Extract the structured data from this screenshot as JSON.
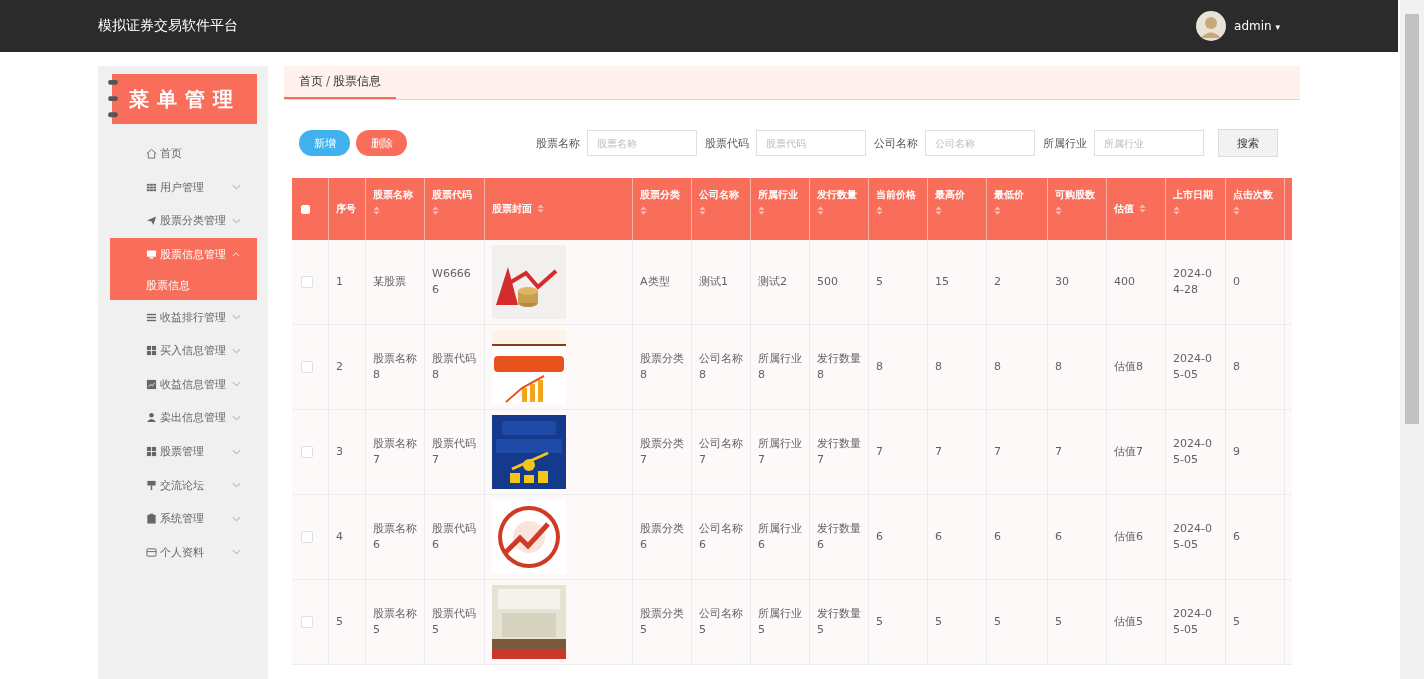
{
  "app_title": "模拟证券交易软件平台",
  "user": {
    "name": "admin",
    "caret": "▾"
  },
  "sidebar": {
    "title": "菜单管理",
    "items": [
      {
        "label": "首页",
        "kind": "home",
        "expandable": false,
        "selected": false
      },
      {
        "label": "用户管理",
        "kind": "grid",
        "expandable": true,
        "expanded": false,
        "selected": false
      },
      {
        "label": "股票分类管理",
        "kind": "plane",
        "expandable": true,
        "expanded": false,
        "selected": false
      },
      {
        "label": "股票信息管理",
        "kind": "monitor",
        "expandable": true,
        "expanded": true,
        "selected": true,
        "children": [
          {
            "label": "股票信息",
            "selected": true
          }
        ]
      },
      {
        "label": "收益排行管理",
        "kind": "list",
        "expandable": true,
        "expanded": false,
        "selected": false
      },
      {
        "label": "买入信息管理",
        "kind": "apps",
        "expandable": true,
        "expanded": false,
        "selected": false
      },
      {
        "label": "收益信息管理",
        "kind": "chart",
        "expandable": true,
        "expanded": false,
        "selected": false
      },
      {
        "label": "卖出信息管理",
        "kind": "user",
        "expandable": true,
        "expanded": false,
        "selected": false
      },
      {
        "label": "股票管理",
        "kind": "apps",
        "expandable": true,
        "expanded": false,
        "selected": false
      },
      {
        "label": "交流论坛",
        "kind": "sign",
        "expandable": true,
        "expanded": false,
        "selected": false
      },
      {
        "label": "系统管理",
        "kind": "clipboard",
        "expandable": true,
        "expanded": false,
        "selected": false
      },
      {
        "label": "个人资料",
        "kind": "card",
        "expandable": true,
        "expanded": false,
        "selected": false
      }
    ]
  },
  "breadcrumb": {
    "items": [
      "首页",
      "股票信息"
    ],
    "separator": "/"
  },
  "toolbar": {
    "buttons": [
      {
        "label": "新增",
        "kind": "add"
      },
      {
        "label": "删除",
        "kind": "delete"
      }
    ],
    "filters": [
      {
        "label": "股票名称",
        "placeholder": "股票名称"
      },
      {
        "label": "股票代码",
        "placeholder": "股票代码"
      },
      {
        "label": "公司名称",
        "placeholder": "公司名称"
      },
      {
        "label": "所属行业",
        "placeholder": "所属行业"
      }
    ],
    "search_button": "搜索"
  },
  "table": {
    "header_checked": false,
    "columns": [
      {
        "kind": "checkbox"
      },
      {
        "kind": "text",
        "label": "序号",
        "sortable": false
      },
      {
        "kind": "text",
        "label": "股票名称",
        "sortable": true
      },
      {
        "kind": "text",
        "label": "股票代码",
        "sortable": true
      },
      {
        "kind": "picture",
        "label": "股票封面",
        "sortable": true
      },
      {
        "kind": "text",
        "label": "股票分类",
        "sortable": true
      },
      {
        "kind": "text",
        "label": "公司名称",
        "sortable": true
      },
      {
        "kind": "text",
        "label": "所属行业",
        "sortable": true
      },
      {
        "kind": "text",
        "label": "发行数量",
        "sortable": true
      },
      {
        "kind": "text",
        "label": "当前价格",
        "sortable": true
      },
      {
        "kind": "text",
        "label": "最高价",
        "sortable": true
      },
      {
        "kind": "text",
        "label": "最低价",
        "sortable": true
      },
      {
        "kind": "text",
        "label": "可购股数",
        "sortable": true
      },
      {
        "kind": "text",
        "label": "估值",
        "sortable": true
      },
      {
        "kind": "text",
        "label": "上市日期",
        "sortable": true
      },
      {
        "kind": "text",
        "label": "点击次数",
        "sortable": true
      }
    ],
    "rows": [
      {
        "checked": false,
        "cells": [
          "",
          "1",
          "某股票",
          "W66666",
          "",
          "A类型",
          "测试1",
          "测试2",
          "500",
          "5",
          "15",
          "2",
          "30",
          "400",
          "2024-04-28",
          "0"
        ]
      },
      {
        "checked": false,
        "cells": [
          "",
          "2",
          "股票名称8",
          "股票代码8",
          "",
          "股票分类8",
          "公司名称8",
          "所属行业8",
          "发行数量8",
          "8",
          "8",
          "8",
          "8",
          "估值8",
          "2024-05-05",
          "8"
        ]
      },
      {
        "checked": false,
        "cells": [
          "",
          "3",
          "股票名称7",
          "股票代码7",
          "",
          "股票分类7",
          "公司名称7",
          "所属行业7",
          "发行数量7",
          "7",
          "7",
          "7",
          "7",
          "估值7",
          "2024-05-05",
          "9"
        ]
      },
      {
        "checked": false,
        "cells": [
          "",
          "4",
          "股票名称6",
          "股票代码6",
          "",
          "股票分类6",
          "公司名称6",
          "所属行业6",
          "发行数量6",
          "6",
          "6",
          "6",
          "6",
          "估值6",
          "2024-05-05",
          "6"
        ]
      },
      {
        "checked": false,
        "cells": [
          "",
          "5",
          "股票名称5",
          "股票代码5",
          "",
          "股票分类5",
          "公司名称5",
          "所属行业5",
          "发行数量5",
          "5",
          "5",
          "5",
          "5",
          "估值5",
          "2024-05-05",
          "5"
        ]
      }
    ]
  }
}
